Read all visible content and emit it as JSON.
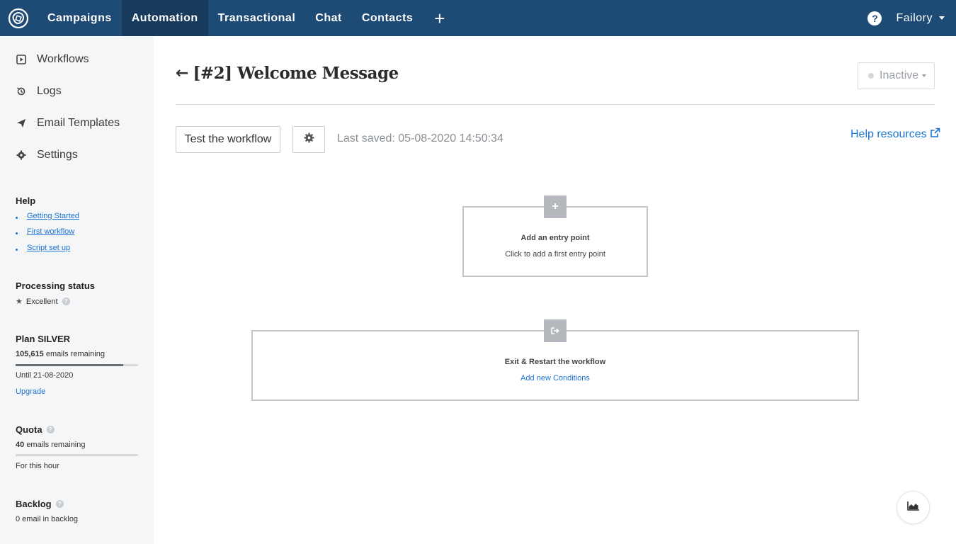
{
  "nav": {
    "items": [
      {
        "label": "Campaigns",
        "active": false
      },
      {
        "label": "Automation",
        "active": true
      },
      {
        "label": "Transactional",
        "active": false
      },
      {
        "label": "Chat",
        "active": false
      },
      {
        "label": "Contacts",
        "active": false
      }
    ],
    "plus_label": "+",
    "account_label": "Failory"
  },
  "sidebar": {
    "links": [
      {
        "label": "Workflows",
        "icon": "play-square-icon"
      },
      {
        "label": "Logs",
        "icon": "history-icon"
      },
      {
        "label": "Email Templates",
        "icon": "paper-plane-icon"
      },
      {
        "label": "Settings",
        "icon": "gear-icon"
      }
    ],
    "help": {
      "heading": "Help",
      "links": [
        "Getting Started",
        "First workflow",
        "Script set up"
      ]
    },
    "processing": {
      "heading": "Processing status",
      "value": "Excellent"
    },
    "plan": {
      "heading": "Plan SILVER",
      "remaining_count": "105,615",
      "remaining_label": "emails remaining",
      "usage_fraction": 0.88,
      "until": "Until 21-08-2020",
      "upgrade_label": "Upgrade"
    },
    "quota": {
      "heading": "Quota",
      "remaining_count": "40",
      "remaining_label": "emails remaining",
      "usage_fraction": 1.0,
      "period": "For this hour"
    },
    "backlog": {
      "heading": "Backlog",
      "value": "0 email in backlog"
    }
  },
  "main": {
    "title": "[#2] Welcome Message",
    "status_label": "Inactive",
    "test_button_label": "Test the workflow",
    "last_saved": "Last saved: 05-08-2020 14:50:34",
    "help_resources_label": "Help resources",
    "entry_box": {
      "title": "Add an entry point",
      "subtitle": "Click to add a first entry point"
    },
    "exit_box": {
      "title": "Exit & Restart the workflow",
      "link": "Add new Conditions"
    }
  },
  "colors": {
    "topbar": "#1e4a76",
    "topbar_active": "#173a5d",
    "link": "#1a73d1",
    "sidebar_bg": "#f5f6f7"
  }
}
